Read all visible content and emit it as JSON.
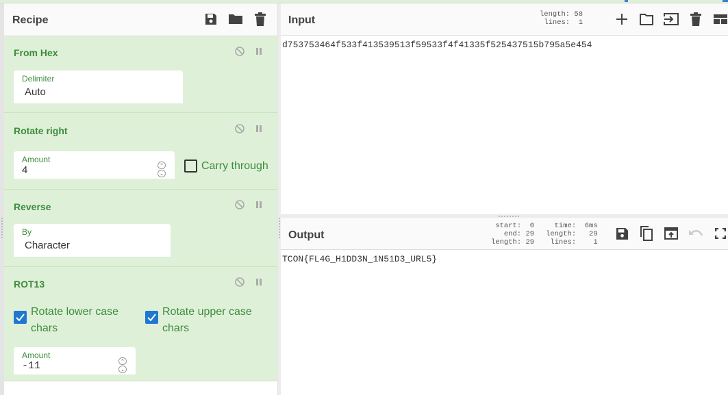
{
  "recipe": {
    "title": "Recipe",
    "header_icons": [
      "save-icon",
      "folder-icon",
      "trash-icon"
    ],
    "operations": [
      {
        "name": "From Hex",
        "fields": [
          {
            "label": "Delimiter",
            "value": "Auto",
            "type": "select"
          }
        ]
      },
      {
        "name": "Rotate right",
        "fields": [
          {
            "label": "Amount",
            "value": "4",
            "type": "number"
          }
        ],
        "checkboxes": [
          {
            "label": "Carry through",
            "checked": false
          }
        ]
      },
      {
        "name": "Reverse",
        "fields": [
          {
            "label": "By",
            "value": "Character",
            "type": "select"
          }
        ]
      },
      {
        "name": "ROT13",
        "checkboxes": [
          {
            "label_line1": "Rotate lower case",
            "label_line2": "chars",
            "checked": true
          },
          {
            "label_line1": "Rotate upper case",
            "label_line2": "chars",
            "checked": true
          }
        ],
        "fields": [
          {
            "label": "Amount",
            "value": "-11",
            "type": "number"
          }
        ]
      }
    ]
  },
  "input": {
    "title": "Input",
    "stats": {
      "length_label": "length:",
      "length": "58",
      "lines_label": "lines:",
      "lines": "1"
    },
    "icons": [
      "plus-icon",
      "open-folder-icon",
      "import-icon",
      "trash-icon",
      "layout-icon"
    ],
    "text": "d753753464f533f413539513f59533f4f41335f525437515b795a5e454"
  },
  "output": {
    "title": "Output",
    "stats": {
      "start_label": "start:",
      "start": "0",
      "end_label": "end:",
      "end": "29",
      "sel_length_label": "length:",
      "sel_length": "29",
      "time_label": "time:",
      "time": "6ms",
      "length_label": "length:",
      "length": "29",
      "lines_label": "lines:",
      "lines": "1"
    },
    "icons": [
      "save-icon",
      "copy-icon",
      "replace-input-icon",
      "undo-icon",
      "fullscreen-icon"
    ],
    "text": "TCON{FL4G_H1DD3N_1N51D3_URL5}"
  },
  "colors": {
    "op_background": "#dff0d8",
    "op_title": "#3c8c3c",
    "checkbox_checked": "#1f77d0"
  }
}
